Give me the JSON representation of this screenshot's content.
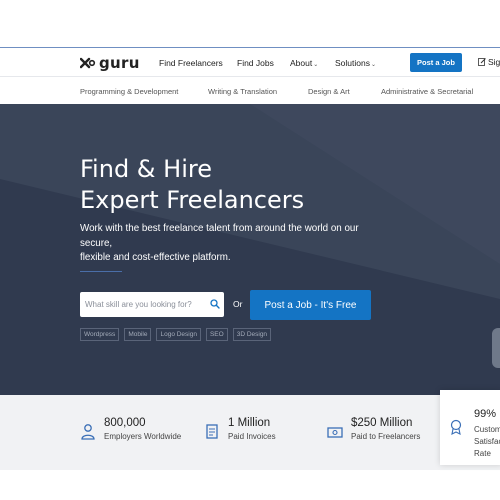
{
  "brand": {
    "name": "guru"
  },
  "nav": {
    "items": [
      {
        "label": "Find Freelancers"
      },
      {
        "label": "Find Jobs"
      },
      {
        "label": "About"
      },
      {
        "label": "Solutions"
      }
    ],
    "post_job_label": "Post a Job",
    "signin_label": "Sign In"
  },
  "categories": [
    "Programming & Development",
    "Writing & Translation",
    "Design & Art",
    "Administrative & Secretarial"
  ],
  "hero": {
    "title_line1": "Find & Hire",
    "title_line2": "Expert Freelancers",
    "subtitle_line1": "Work with the best freelance talent from around the world on our secure,",
    "subtitle_line2": "flexible and cost-effective platform.",
    "search_placeholder": "What skill are you looking for?",
    "or_label": "Or",
    "cta_label": "Post a Job - It's Free",
    "tags": [
      "Wordpress",
      "Mobile",
      "Logo Design",
      "SEO",
      "3D Design"
    ]
  },
  "stats": [
    {
      "value": "800,000",
      "label": "Employers Worldwide",
      "icon": "user-icon"
    },
    {
      "value": "1 Million",
      "label": "Paid Invoices",
      "icon": "invoice-icon"
    },
    {
      "value": "$250 Million",
      "label": "Paid to Freelancers",
      "icon": "money-icon"
    }
  ],
  "stat_card": {
    "value": "99%",
    "label": "Customer Satisfaction Rate",
    "icon": "award-icon"
  },
  "colors": {
    "primary": "#1474c4",
    "hero_bg": "#303a4f",
    "stats_bg": "#f1f2f4"
  }
}
